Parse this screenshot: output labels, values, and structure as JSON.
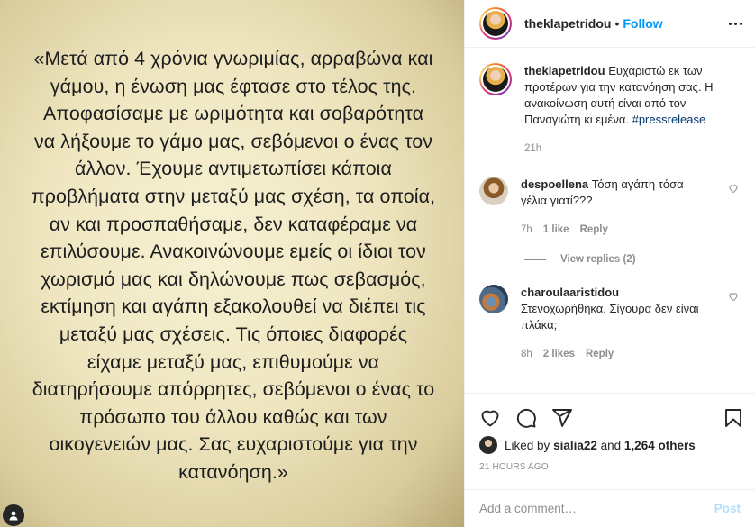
{
  "post_image": {
    "text_lines": [
      "«Μετά από 4 χρόνια γνωριμίας, αρραβώνα και",
      "γάμου, η ένωση μας έφτασε στο τέλος της.",
      "Αποφασίσαμε με ωριμότητα και σοβαρότητα",
      "να λήξουμε το γάμο μας, σεβόμενοι ο ένας τον",
      "άλλον. Έχουμε αντιμετωπίσει κάποια",
      "προβλήματα στην μεταξύ μας σχέση, τα οποία,",
      "αν και  προσπαθήσαμε, δεν καταφέραμε να",
      "επιλύσουμε. Ανακοινώνουμε εμείς οι ίδιοι τον",
      "χωρισμό μας και δηλώνουμε πως σεβασμός,",
      "εκτίμηση και αγάπη εξακολουθεί να διέπει τις",
      "μεταξύ μας σχέσεις. Τις όποιες διαφορές",
      "είχαμε μεταξύ μας, επιθυμούμε να",
      "διατηρήσουμε απόρρητες, σεβόμενοι ο ένας το",
      "πρόσωπο του άλλου καθώς και των",
      "οικογενειών μας. Σας ευχαριστούμε για την",
      "κατανόηση.»"
    ]
  },
  "header": {
    "username": "theklapetridou",
    "separator": "•",
    "follow_label": "Follow"
  },
  "caption": {
    "username": "theklapetridou",
    "text": "Ευχαριστώ εκ των προτέρων για την κατανόηση σας. Η ανακοίνωση αυτή είναι από τον Παναγιώτη κι εμένα.",
    "hashtag": "#pressrelease",
    "time": "21h"
  },
  "comments": [
    {
      "username": "despoellena",
      "text": "Τόση αγάπη τόσα γέλια γιατί???",
      "time": "7h",
      "likes": "1 like",
      "reply": "Reply",
      "view_replies": "View replies (2)"
    },
    {
      "username": "charoulaaristidou",
      "text": "Στενοχωρήθηκα. Σίγουρα δεν είναι πλάκα;",
      "time": "8h",
      "likes": "2 likes",
      "reply": "Reply"
    }
  ],
  "likes": {
    "prefix": "Liked by",
    "user": "sialia22",
    "connector": "and",
    "others": "1,264 others"
  },
  "timestamp": "21 HOURS AGO",
  "add_comment": {
    "placeholder": "Add a comment…",
    "post_label": "Post"
  },
  "icons": [
    "heart-icon",
    "comment-icon",
    "share-icon",
    "bookmark-icon",
    "more-options-icon",
    "tagged-user-icon"
  ],
  "colors": {
    "link_blue": "#0095f6",
    "hashtag_blue": "#00376b",
    "muted_gray": "#8e8e8e",
    "post_disabled": "#b2dffc"
  }
}
